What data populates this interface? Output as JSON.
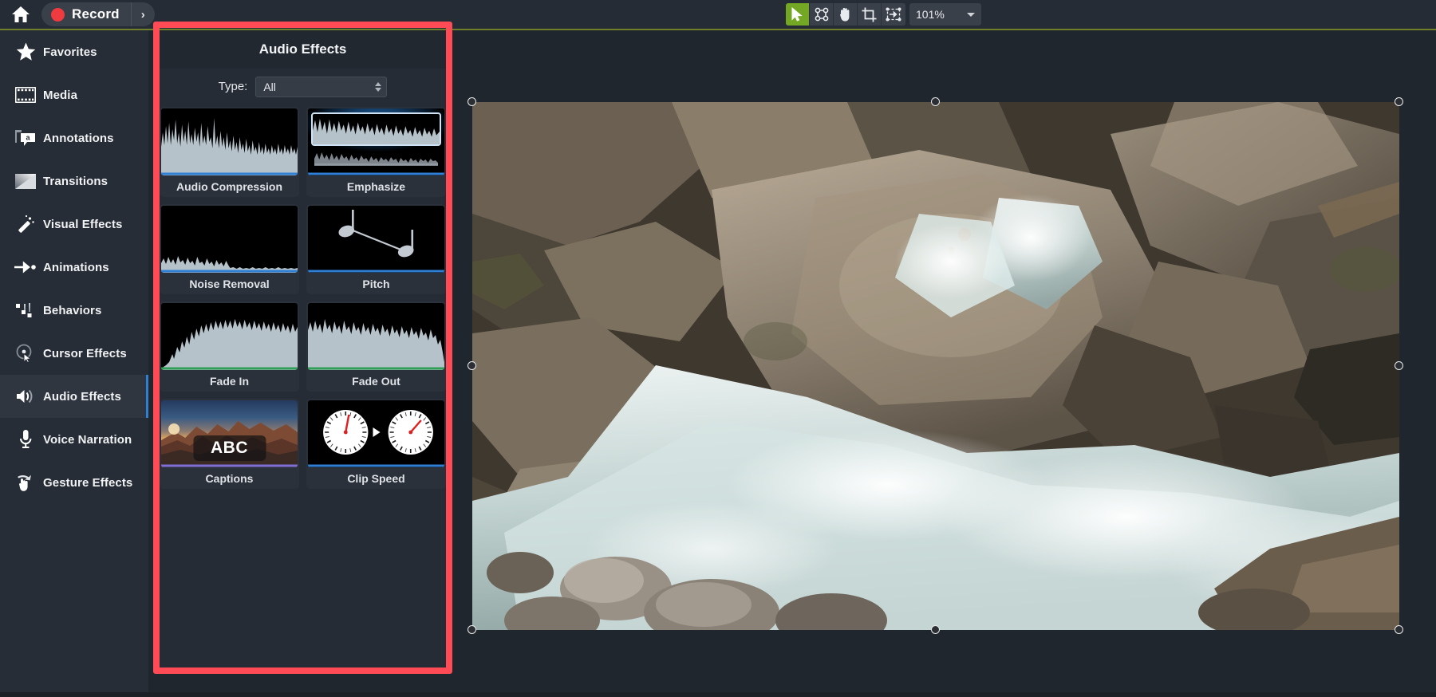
{
  "topbar": {
    "home_icon": "home-icon",
    "record_label": "Record",
    "record_caret": "›",
    "tools": [
      {
        "name": "select-tool",
        "icon": "arrow-cursor-icon",
        "active": true
      },
      {
        "name": "node-edit-tool",
        "icon": "node-points-icon",
        "active": false
      },
      {
        "name": "hand-tool",
        "icon": "hand-icon",
        "active": false
      },
      {
        "name": "crop-tool",
        "icon": "crop-icon",
        "active": false
      },
      {
        "name": "transform-tool",
        "icon": "transform-arrow-icon",
        "active": false
      }
    ],
    "zoom_value": "101%",
    "accent_green": "#73a724",
    "record_red": "#ef3a3f"
  },
  "sidebar": {
    "items": [
      {
        "label": "Favorites",
        "icon": "star-icon",
        "active": false
      },
      {
        "label": "Media",
        "icon": "film-strip-icon",
        "active": false
      },
      {
        "label": "Annotations",
        "icon": "speech-bubble-icon",
        "active": false
      },
      {
        "label": "Transitions",
        "icon": "gradient-square-icon",
        "active": false
      },
      {
        "label": "Visual Effects",
        "icon": "magic-wand-icon",
        "active": false
      },
      {
        "label": "Animations",
        "icon": "arrow-motion-icon",
        "active": false
      },
      {
        "label": "Behaviors",
        "icon": "behaviors-icon",
        "active": false
      },
      {
        "label": "Cursor Effects",
        "icon": "cursor-ring-icon",
        "active": false
      },
      {
        "label": "Audio Effects",
        "icon": "speaker-icon",
        "active": true
      },
      {
        "label": "Voice Narration",
        "icon": "microphone-icon",
        "active": false
      },
      {
        "label": "Gesture Effects",
        "icon": "pointing-hand-icon",
        "active": false
      }
    ],
    "active_indicator_color": "#2f7fd4"
  },
  "panel": {
    "title": "Audio Effects",
    "filter_label": "Type:",
    "filter_value": "All",
    "effects": [
      {
        "label": "Audio Compression",
        "thumb": "waveform-compressed"
      },
      {
        "label": "Emphasize",
        "thumb": "waveform-emphasize-selected"
      },
      {
        "label": "Noise Removal",
        "thumb": "waveform-noise-low"
      },
      {
        "label": "Pitch",
        "thumb": "music-notes"
      },
      {
        "label": "Fade In",
        "thumb": "waveform-fade-in"
      },
      {
        "label": "Fade Out",
        "thumb": "waveform-fade-out"
      },
      {
        "label": "Captions",
        "thumb": "mountain-photo-abc"
      },
      {
        "label": "Clip Speed",
        "thumb": "two-speedometers"
      }
    ],
    "captions_overlay_text": "ABC"
  },
  "highlight": {
    "color": "#ff4b55",
    "target": "audio-effects-panel"
  },
  "canvas": {
    "zoom": "101%",
    "selection_handles": 8,
    "content": "waterfall-over-rocks-photo"
  }
}
